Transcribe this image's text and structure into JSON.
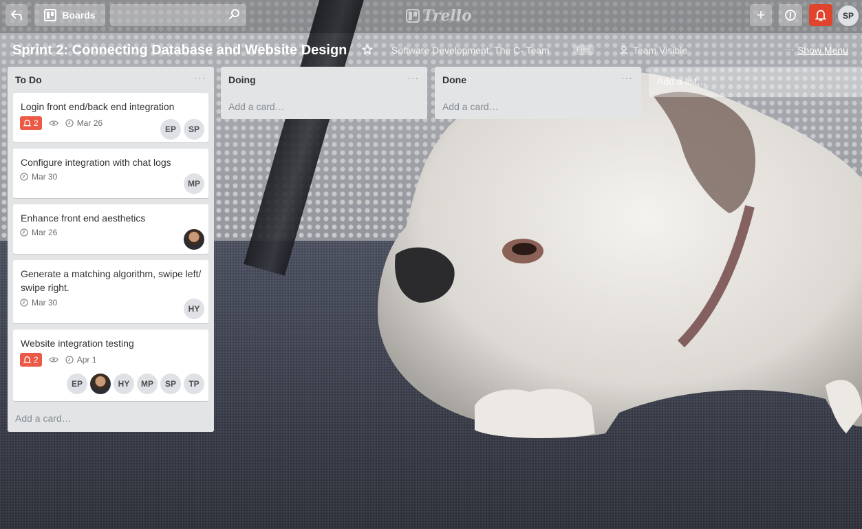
{
  "nav": {
    "boards_label": "Boards",
    "search_value": "",
    "logo_text": "Trello",
    "add_label": "+",
    "user_initials": "SP"
  },
  "board": {
    "title": "Sprint 2: Connecting Database and Website Design",
    "org_name": "Software Development: The C- Team",
    "org_badge": "Free",
    "visibility": "Team Visible",
    "menu_dots": "···",
    "show_menu": "Show Menu"
  },
  "lists": [
    {
      "title": "To Do",
      "menu": "···",
      "add_card": "Add a card…",
      "cards": [
        {
          "title": "Login front end/back end integration",
          "notif_count": "2",
          "due": "Mar 26",
          "members": [
            "EP",
            "SP"
          ]
        },
        {
          "title": "Configure integration with chat logs",
          "due": "Mar 30",
          "members": [
            "MP"
          ]
        },
        {
          "title": "Enhance front end aesthetics",
          "due": "Mar 26"
        },
        {
          "title": "Generate a matching algorithm, swipe left/ swipe right.",
          "due": "Mar 30",
          "members": [
            "HY"
          ]
        },
        {
          "title": "Website integration testing",
          "notif_count": "2",
          "due": "Apr 1",
          "members": [
            "EP",
            "HY",
            "MP",
            "SP",
            "TP"
          ]
        }
      ]
    },
    {
      "title": "Doing",
      "menu": "···",
      "add_card": "Add a card…"
    },
    {
      "title": "Done",
      "menu": "···",
      "add_card": "Add a card…"
    }
  ],
  "add_list": "Add a list…",
  "colors": {
    "accent_red": "#eb5a46",
    "list_bg": "#e2e4e6"
  }
}
